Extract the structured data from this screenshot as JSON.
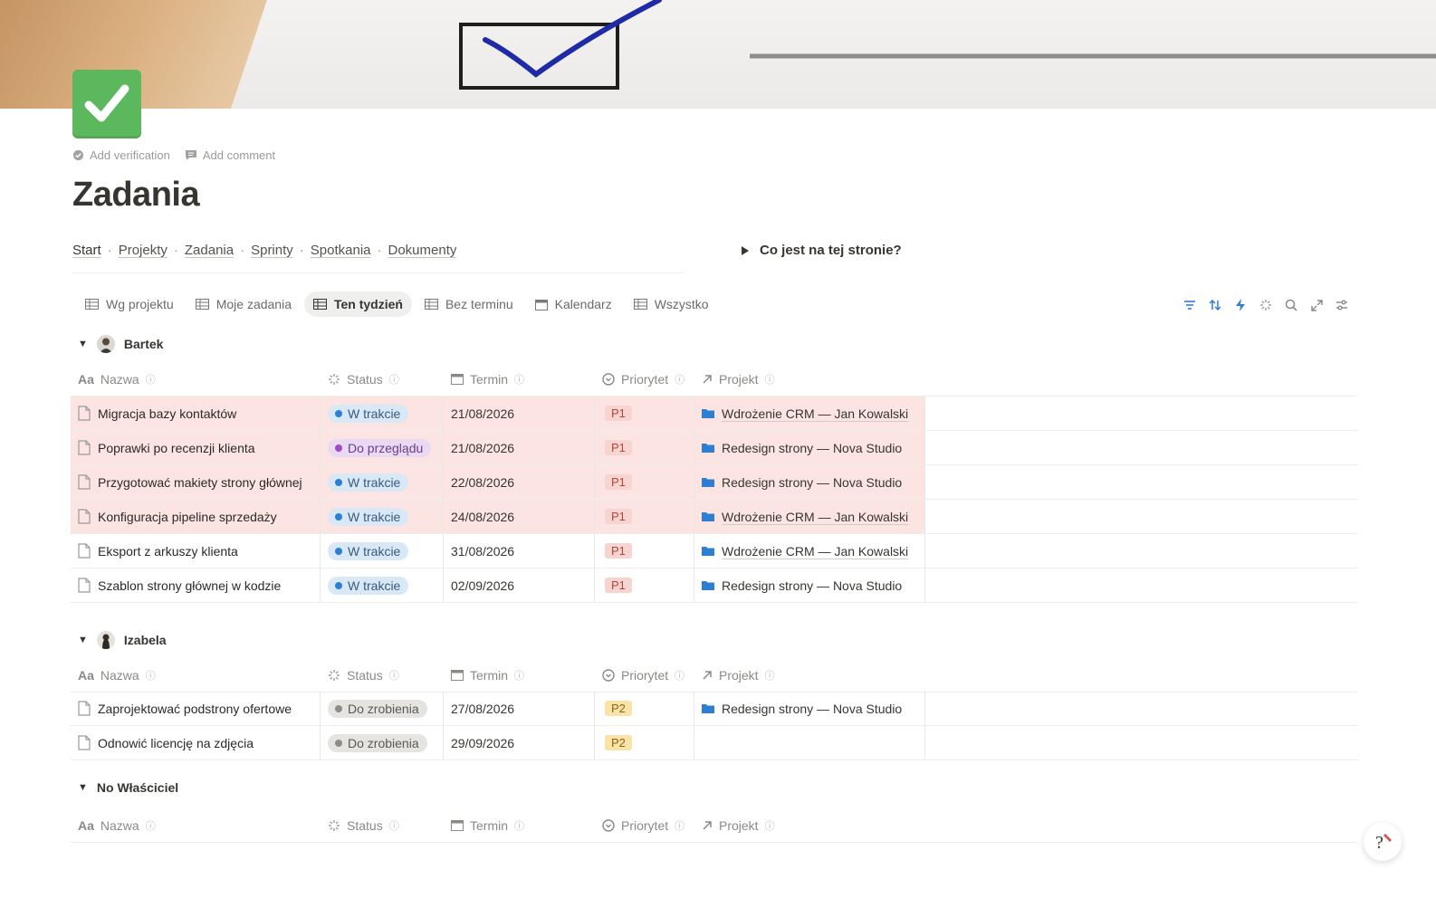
{
  "page": {
    "title": "Zadania",
    "add_verification": "Add verification",
    "add_comment": "Add comment"
  },
  "nav": {
    "items": [
      "Start",
      "Projekty",
      "Zadania",
      "Sprinty",
      "Spotkania",
      "Dokumenty"
    ],
    "separator": "·"
  },
  "toggle_question": "Co jest na tej stronie?",
  "tabs": [
    {
      "label": "Wg projektu",
      "icon": "table-icon"
    },
    {
      "label": "Moje zadania",
      "icon": "table-icon"
    },
    {
      "label": "Ten tydzień",
      "icon": "table-icon",
      "active": true
    },
    {
      "label": "Bez terminu",
      "icon": "table-icon"
    },
    {
      "label": "Kalendarz",
      "icon": "calendar-icon"
    },
    {
      "label": "Wszystko",
      "icon": "table-icon"
    }
  ],
  "tools": [
    "filter-icon",
    "sort-icon",
    "automation-icon",
    "loading-icon",
    "search-icon",
    "expand-icon",
    "settings-icon"
  ],
  "columns": {
    "name": "Nazwa",
    "name_prefix": "Aa",
    "status": "Status",
    "due": "Termin",
    "priority": "Priorytet",
    "project": "Projekt"
  },
  "groups": [
    {
      "owner": "Bartek",
      "rows": [
        {
          "name": "Migracja bazy kontaktów",
          "status": "W trakcie",
          "status_color": "blue",
          "due": "21/08/2026",
          "priority": "P1",
          "project": "Wdrożenie CRM — Jan Kowalski",
          "highlight": true
        },
        {
          "name": "Poprawki po recenzji klienta",
          "status": "Do przeglądu",
          "status_color": "purple",
          "due": "21/08/2026",
          "priority": "P1",
          "project": "Redesign strony — Nova Studio",
          "highlight": true
        },
        {
          "name": "Przygotować makiety strony głównej",
          "status": "W trakcie",
          "status_color": "blue",
          "due": "22/08/2026",
          "priority": "P1",
          "project": "Redesign strony — Nova Studio",
          "highlight": true
        },
        {
          "name": "Konfiguracja pipeline sprzedaży",
          "status": "W trakcie",
          "status_color": "blue",
          "due": "24/08/2026",
          "priority": "P1",
          "project": "Wdrożenie CRM — Jan Kowalski",
          "highlight": true
        },
        {
          "name": "Eksport z arkuszy klienta",
          "status": "W trakcie",
          "status_color": "blue",
          "due": "31/08/2026",
          "priority": "P1",
          "project": "Wdrożenie CRM — Jan Kowalski",
          "highlight": false
        },
        {
          "name": "Szablon strony głównej w kodzie",
          "status": "W trakcie",
          "status_color": "blue",
          "due": "02/09/2026",
          "priority": "P1",
          "project": "Redesign strony — Nova Studio",
          "highlight": false
        }
      ]
    },
    {
      "owner": "Izabela",
      "rows": [
        {
          "name": "Zaprojektować podstrony ofertowe",
          "status": "Do zrobienia",
          "status_color": "gray",
          "due": "27/08/2026",
          "priority": "P2",
          "project": "Redesign strony — Nova Studio",
          "highlight": false
        },
        {
          "name": "Odnowić licencję na zdjęcia",
          "status": "Do zrobienia",
          "status_color": "gray",
          "due": "29/09/2026",
          "priority": "P2",
          "project": "",
          "highlight": false
        }
      ]
    },
    {
      "owner": "No Właściciel",
      "rows": []
    }
  ],
  "colors": {
    "highlight_row": "#fbe4e2",
    "accent_blue": "#2e7fd1",
    "page_icon_green": "#5cb85c"
  },
  "help_icon": "help-icon"
}
